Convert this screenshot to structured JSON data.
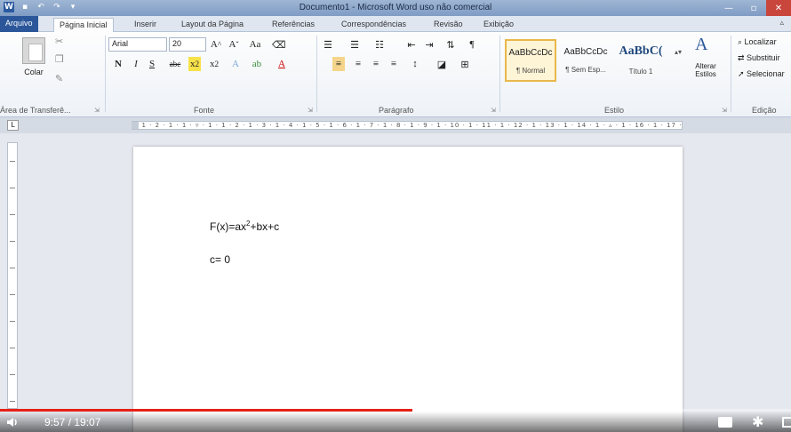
{
  "window": {
    "title": "Documento1 - Microsoft Word uso não comercial"
  },
  "tabs": [
    {
      "label": "Arquivo"
    },
    {
      "label": "Página Inicial"
    },
    {
      "label": "Inserir"
    },
    {
      "label": "Layout da Página"
    },
    {
      "label": "Referências"
    },
    {
      "label": "Correspondências"
    },
    {
      "label": "Revisão"
    },
    {
      "label": "Exibição"
    }
  ],
  "ribbon": {
    "clipboard": {
      "paste_label": "Colar",
      "group_label": "Área de Transferê..."
    },
    "font": {
      "name": "Arial",
      "size": "20",
      "group_label": "Fonte"
    },
    "paragraph": {
      "group_label": "Parágrafo"
    },
    "styles": {
      "group_label": "Estilo",
      "items": [
        {
          "sample": "AaBbCcDc",
          "name": "¶ Normal"
        },
        {
          "sample": "AaBbCcDc",
          "name": "¶ Sem Esp..."
        },
        {
          "sample": "AaBbC(",
          "name": "Título 1"
        }
      ],
      "change_styles": "Alterar Estilos"
    },
    "editing": {
      "group_label": "Edição",
      "find": "Localizar",
      "replace": "Substituir",
      "select": "Selecionar"
    }
  },
  "document": {
    "line1_base": "F(x)=ax",
    "line1_sup": "2",
    "line1_rest": "+bx+c",
    "line2": "c= 0"
  },
  "player": {
    "time": "9:57 / 19:07",
    "progress_fraction": 0.521,
    "buffered_fraction": 0.69
  }
}
